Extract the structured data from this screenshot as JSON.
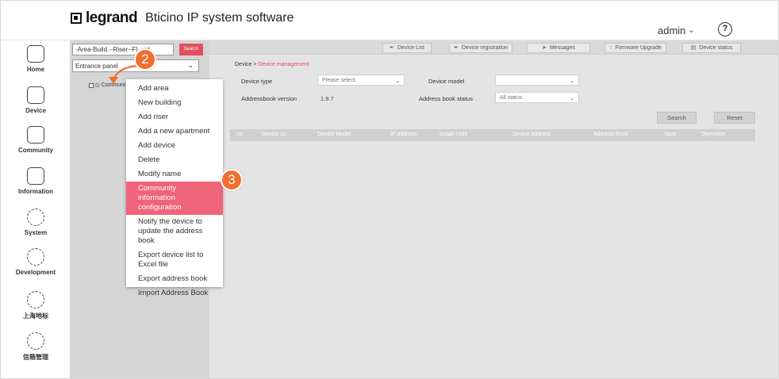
{
  "header": {
    "brand": "legrand",
    "app_title": "Bticino IP system software",
    "user": "admin",
    "help": "?"
  },
  "nav": {
    "items": [
      {
        "label": "Home",
        "icon": "home-icon"
      },
      {
        "label": "Device",
        "icon": "device-icon"
      },
      {
        "label": "Community",
        "icon": "community-icon"
      },
      {
        "label": "Information",
        "icon": "information-icon"
      },
      {
        "label": "System",
        "icon": "gear-icon"
      },
      {
        "label": "Development",
        "icon": "gear-icon"
      },
      {
        "label": "上海地标",
        "icon": "gear-icon"
      },
      {
        "label": "信箱管理",
        "icon": "gear-icon"
      }
    ]
  },
  "tree": {
    "search_value": "-Area-Build.--Riser--Fl... nt.",
    "search_button": "Search",
    "select_value": "Entrance panel",
    "node_label": "Communi"
  },
  "context_menu": {
    "items": [
      "Add area",
      "New building",
      "Add riser",
      "Add a new apartment",
      "Add device",
      "Delete",
      "Modify name",
      "Community information configuration",
      "Notify the device to update the address book",
      "Export device list to Excel file",
      "Export address book",
      "Import Address Book"
    ],
    "active_index": 7
  },
  "callouts": {
    "first": "2",
    "second": "3"
  },
  "toolbar": {
    "device_list": "Device List",
    "device_registration": "Device registration",
    "messages": "Messages",
    "firmware_upgrade": "Firmware Upgrade",
    "device_status": "Device status"
  },
  "breadcrumb": {
    "root": "Device",
    "sep": ">",
    "current": "Device management"
  },
  "filters": {
    "device_type_label": "Device type",
    "device_type_value": "Please select",
    "device_model_label": "Device model",
    "device_model_value": "",
    "addressbook_version_label": "Addressbook version",
    "addressbook_version_value": "1.9.7",
    "address_book_status_label": "Address book status",
    "address_book_status_value": "All status",
    "search_button": "Search",
    "reset_button": "Reset"
  },
  "table": {
    "columns": [
      "no",
      "Device uc",
      "Device Model",
      "IP address",
      "Install code",
      "Device address",
      "Address Book",
      "Note",
      "Operation"
    ]
  },
  "colors": {
    "accent": "#e25060",
    "callout": "#ef6f2e",
    "active_menu": "#f0647a"
  }
}
